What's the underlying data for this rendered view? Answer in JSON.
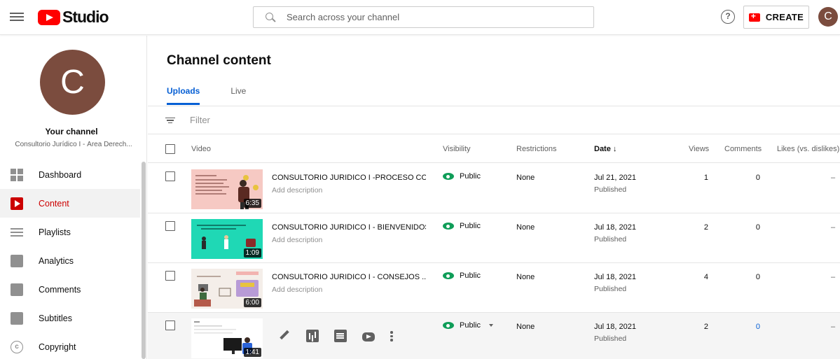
{
  "header": {
    "logo_text": "Studio",
    "search_placeholder": "Search across your channel",
    "help_icon": "?",
    "create_label": "CREATE",
    "avatar_letter": "C"
  },
  "sidebar": {
    "avatar_letter": "C",
    "channel_title": "Your channel",
    "channel_name": "Consultorio Jurídico I - Área Derech...",
    "items": [
      {
        "label": "Dashboard",
        "icon": "dashboard-icon",
        "active": false
      },
      {
        "label": "Content",
        "icon": "content-icon",
        "active": true
      },
      {
        "label": "Playlists",
        "icon": "playlists-icon",
        "active": false
      },
      {
        "label": "Analytics",
        "icon": "analytics-icon",
        "active": false
      },
      {
        "label": "Comments",
        "icon": "comments-icon",
        "active": false
      },
      {
        "label": "Subtitles",
        "icon": "subtitles-icon",
        "active": false
      },
      {
        "label": "Copyright",
        "icon": "copyright-icon",
        "active": false
      }
    ],
    "copyright_glyph": "c"
  },
  "main": {
    "title": "Channel content",
    "tabs": [
      {
        "label": "Uploads",
        "active": true
      },
      {
        "label": "Live",
        "active": false
      }
    ],
    "filter_placeholder": "Filter",
    "columns": {
      "video": "Video",
      "visibility": "Visibility",
      "restrictions": "Restrictions",
      "date": "Date ↓",
      "views": "Views",
      "comments": "Comments",
      "likes": "Likes (vs. dislikes)"
    },
    "rows": [
      {
        "title": "CONSULTORIO JURIDICO I -PROCESO CO...",
        "description": "Add description",
        "duration": "6:35",
        "visibility": "Public",
        "restrictions": "None",
        "date": "Jul 21, 2021",
        "status": "Published",
        "views": "1",
        "comments": "0",
        "likes": "–"
      },
      {
        "title": "CONSULTORIO JURIDICO I - BIENVENIDOS",
        "description": "Add description",
        "duration": "1:09",
        "visibility": "Public",
        "restrictions": "None",
        "date": "Jul 18, 2021",
        "status": "Published",
        "views": "2",
        "comments": "0",
        "likes": "–"
      },
      {
        "title": "CONSULTORIO JURIDICO I - CONSEJOS ...",
        "description": "Add description",
        "duration": "6:00",
        "visibility": "Public",
        "restrictions": "None",
        "date": "Jul 18, 2021",
        "status": "Published",
        "views": "4",
        "comments": "0",
        "likes": "–"
      },
      {
        "title": "",
        "description": "",
        "duration": "1:41",
        "visibility": "Public",
        "restrictions": "None",
        "date": "Jul 18, 2021",
        "status": "Published",
        "views": "2",
        "comments": "0",
        "likes": "–"
      }
    ]
  },
  "colors": {
    "brand_red": "#ff0000",
    "active_red": "#cc0000",
    "link_blue": "#065fd4",
    "public_green": "#0f9d58",
    "avatar_brown": "#7b4c3e"
  }
}
